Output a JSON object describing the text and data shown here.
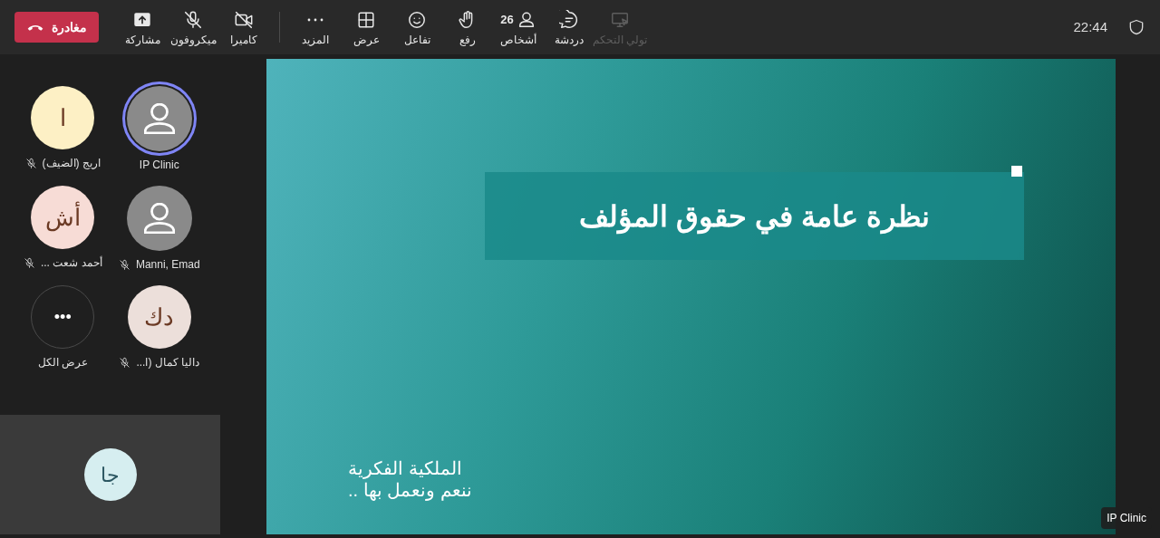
{
  "toolbar": {
    "clock": "22:44",
    "tools": [
      {
        "kind": "take-control",
        "label": "تولي التحكم",
        "disabled": true
      },
      {
        "kind": "chat",
        "label": "دردشة",
        "disabled": false
      },
      {
        "kind": "people",
        "label": "أشخاص",
        "disabled": false,
        "count": "26"
      },
      {
        "kind": "hand",
        "label": "رفع",
        "disabled": false
      },
      {
        "kind": "react",
        "label": "تفاعل",
        "disabled": false
      },
      {
        "kind": "view",
        "label": "عرض",
        "disabled": false
      },
      {
        "kind": "more",
        "label": "المزيد",
        "disabled": false
      },
      {
        "kind": "camera",
        "label": "كاميرا",
        "disabled": false,
        "off": true
      },
      {
        "kind": "mic",
        "label": "ميكروفون",
        "disabled": false,
        "off": true
      },
      {
        "kind": "share",
        "label": "مشاركة",
        "disabled": false
      }
    ],
    "leave": {
      "label": "مغادرة"
    }
  },
  "participants": [
    {
      "kind": "avatar",
      "name": "IP Clinic",
      "speaking": true,
      "muted": false
    },
    {
      "kind": "initials",
      "initials": "ا",
      "name": "اريج (الضيف)",
      "color": "#fdf0c5",
      "speaking": false,
      "muted": true
    },
    {
      "kind": "avatar",
      "name": "Manni, Emad",
      "speaking": false,
      "muted": true
    },
    {
      "kind": "initials",
      "initials": "أش",
      "name": "أحمد شعت ...",
      "color": "#f7dcd6",
      "speaking": false,
      "muted": true
    },
    {
      "kind": "initials",
      "initials": "دك",
      "name": "داليا كمال (ا...",
      "color": "#ecdfda",
      "speaking": false,
      "muted": true
    },
    {
      "kind": "more",
      "icon": "•••",
      "name": "عرض الكل"
    }
  ],
  "self_view": {
    "initials": "جا"
  },
  "stage": {
    "slide": {
      "title": "نظرة عامة في حقوق المؤلف",
      "lines": [
        "الملكية الفكرية",
        "ننعم ونعمل بها .."
      ]
    },
    "presenter": "IP Clinic"
  }
}
